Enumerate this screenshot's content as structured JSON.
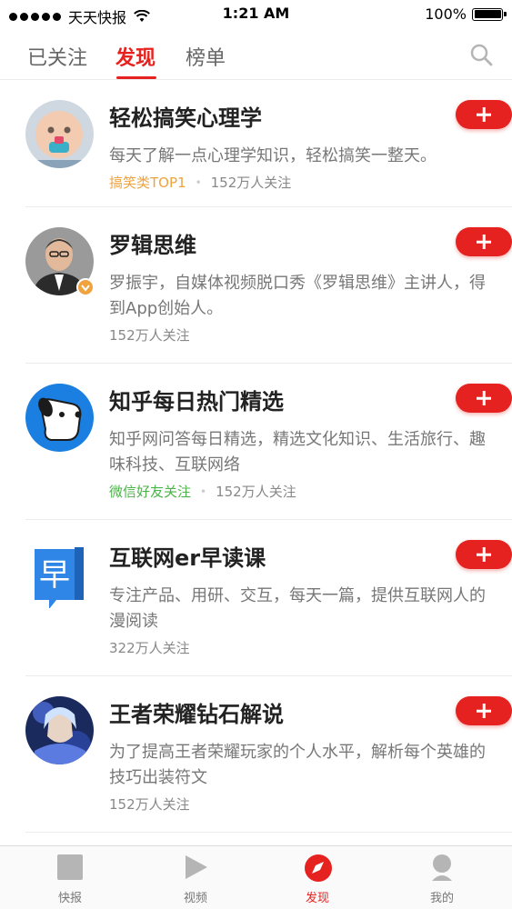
{
  "status_bar": {
    "carrier": "天天快报",
    "time": "1:21 AM",
    "battery": "100%"
  },
  "top_tabs": [
    {
      "label": "已关注",
      "active": false
    },
    {
      "label": "发现",
      "active": true
    },
    {
      "label": "榜单",
      "active": false
    }
  ],
  "feed": [
    {
      "title": "轻松搞笑心理学",
      "desc": "每天了解一点心理学知识，轻松搞笑一整天。",
      "tag": "搞笑类TOP1",
      "tag_color": "orange",
      "followers": "152万人关注",
      "avatar": "baby-avatar"
    },
    {
      "title": "罗辑思维",
      "desc": "罗振宇，自媒体视频脱口秀《罗辑思维》主讲人，得到App创始人。",
      "tag": "",
      "followers": "152万人关注",
      "avatar": "man-avatar"
    },
    {
      "title": "知乎每日热门精选",
      "desc": "知乎网问答每日精选，精选文化知识、生活旅行、趣味科技、互联网络",
      "tag": "微信好友关注",
      "tag_color": "green",
      "followers": "152万人关注",
      "avatar": "dog-avatar"
    },
    {
      "title": "互联网er早读课",
      "desc": "专注产品、用研、交互，每天一篇，提供互联网人的漫阅读",
      "tag": "",
      "followers": "322万人关注",
      "avatar": "book-avatar"
    },
    {
      "title": "王者荣耀钻石解说",
      "desc": "为了提高王者荣耀玩家的个人水平，解析每个英雄的技巧出装符文",
      "tag": "",
      "followers": "152万人关注",
      "avatar": "game-avatar"
    }
  ],
  "avatar_glyphs": {
    "book": "早"
  },
  "bottom_tabs": [
    {
      "label": "快报",
      "icon": "news-icon",
      "active": false
    },
    {
      "label": "视频",
      "icon": "play-icon",
      "active": false
    },
    {
      "label": "发现",
      "icon": "compass-icon",
      "active": true
    },
    {
      "label": "我的",
      "icon": "user-icon",
      "active": false
    }
  ],
  "colors": {
    "accent": "#e5221f",
    "tag_orange": "#f0a23c",
    "tag_green": "#4cb24a"
  }
}
